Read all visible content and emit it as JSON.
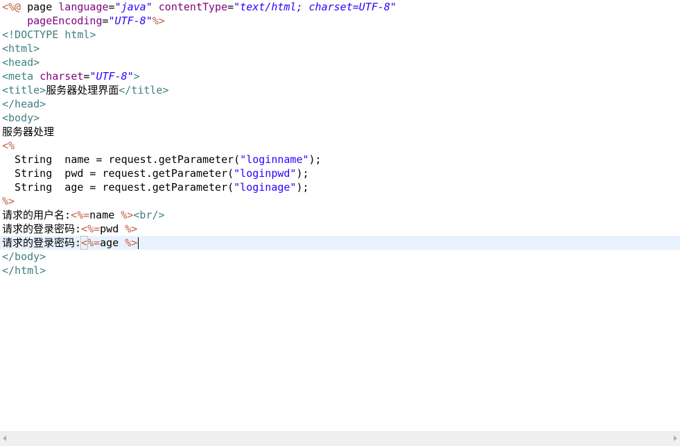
{
  "editor": {
    "lines": [
      {
        "parts": [
          {
            "t": "<%@",
            "c": "jsp"
          },
          {
            "t": " page "
          },
          {
            "t": "language",
            "c": "attr"
          },
          {
            "t": "="
          },
          {
            "t": "\"java\"",
            "c": "val"
          },
          {
            "t": " "
          },
          {
            "t": "contentType",
            "c": "attr"
          },
          {
            "t": "="
          },
          {
            "t": "\"text/html; charset=UTF-8\"",
            "c": "val"
          }
        ]
      },
      {
        "parts": [
          {
            "t": "    "
          },
          {
            "t": "pageEncoding",
            "c": "attr"
          },
          {
            "t": "="
          },
          {
            "t": "\"UTF-8\"",
            "c": "val"
          },
          {
            "t": "%>",
            "c": "jsp"
          }
        ]
      },
      {
        "parts": [
          {
            "t": "<!DOCTYPE ",
            "c": "tag"
          },
          {
            "t": "html",
            "c": "tagname"
          },
          {
            "t": ">",
            "c": "tag"
          }
        ]
      },
      {
        "parts": [
          {
            "t": "<html>",
            "c": "tag"
          }
        ]
      },
      {
        "parts": [
          {
            "t": "<head>",
            "c": "tag"
          }
        ]
      },
      {
        "parts": [
          {
            "t": "<meta ",
            "c": "tag"
          },
          {
            "t": "charset",
            "c": "attr"
          },
          {
            "t": "="
          },
          {
            "t": "\"UTF-8\"",
            "c": "val"
          },
          {
            "t": ">",
            "c": "tag"
          }
        ]
      },
      {
        "parts": [
          {
            "t": "<title>",
            "c": "tag"
          },
          {
            "t": "服务器处理界面"
          },
          {
            "t": "</title>",
            "c": "tag"
          }
        ]
      },
      {
        "parts": [
          {
            "t": "</head>",
            "c": "tag"
          }
        ]
      },
      {
        "parts": [
          {
            "t": "<body>",
            "c": "tag"
          }
        ]
      },
      {
        "parts": [
          {
            "t": "服务器处理"
          }
        ]
      },
      {
        "parts": [
          {
            "t": "<%",
            "c": "jsp"
          }
        ]
      },
      {
        "parts": [
          {
            "t": "  String  name = request.getParameter("
          },
          {
            "t": "\"loginname\"",
            "c": "str"
          },
          {
            "t": ");"
          }
        ]
      },
      {
        "parts": [
          {
            "t": "  String  pwd = request.getParameter("
          },
          {
            "t": "\"loginpwd\"",
            "c": "str"
          },
          {
            "t": ");"
          }
        ]
      },
      {
        "parts": [
          {
            "t": "  String  age = request.getParameter("
          },
          {
            "t": "\"loginage\"",
            "c": "str"
          },
          {
            "t": ");"
          }
        ]
      },
      {
        "parts": [
          {
            "t": "%>",
            "c": "jsp"
          }
        ]
      },
      {
        "parts": [
          {
            "t": "请求的用户名:"
          },
          {
            "t": "<%=",
            "c": "jsp"
          },
          {
            "t": "name "
          },
          {
            "t": "%>",
            "c": "jsp"
          },
          {
            "t": "<br/>",
            "c": "tag"
          }
        ]
      },
      {
        "parts": [
          {
            "t": "请求的登录密码:"
          },
          {
            "t": "<%=",
            "c": "jsp"
          },
          {
            "t": "pwd "
          },
          {
            "t": "%>",
            "c": "jsp"
          }
        ]
      },
      {
        "current": true,
        "parts": [
          {
            "t": "请求的登录密码:"
          },
          {
            "t": "<",
            "c": "jsp bracket-match"
          },
          {
            "t": "%=",
            "c": "jsp"
          },
          {
            "t": "age "
          },
          {
            "t": "%>",
            "c": "jsp"
          },
          {
            "caret": true
          }
        ]
      },
      {
        "parts": [
          {
            "t": "</body>",
            "c": "tag"
          }
        ]
      },
      {
        "parts": [
          {
            "t": "</html>",
            "c": "tag"
          }
        ]
      }
    ]
  },
  "colors": {
    "jsp_delimiter": "#bf5f3f",
    "attribute": "#7f007f",
    "attribute_value": "#2a00ff",
    "tag": "#3f7f7f",
    "current_line": "#e8f2fe"
  },
  "icons": {
    "scroll_left": "arrow-left-icon",
    "scroll_right": "arrow-right-icon"
  }
}
